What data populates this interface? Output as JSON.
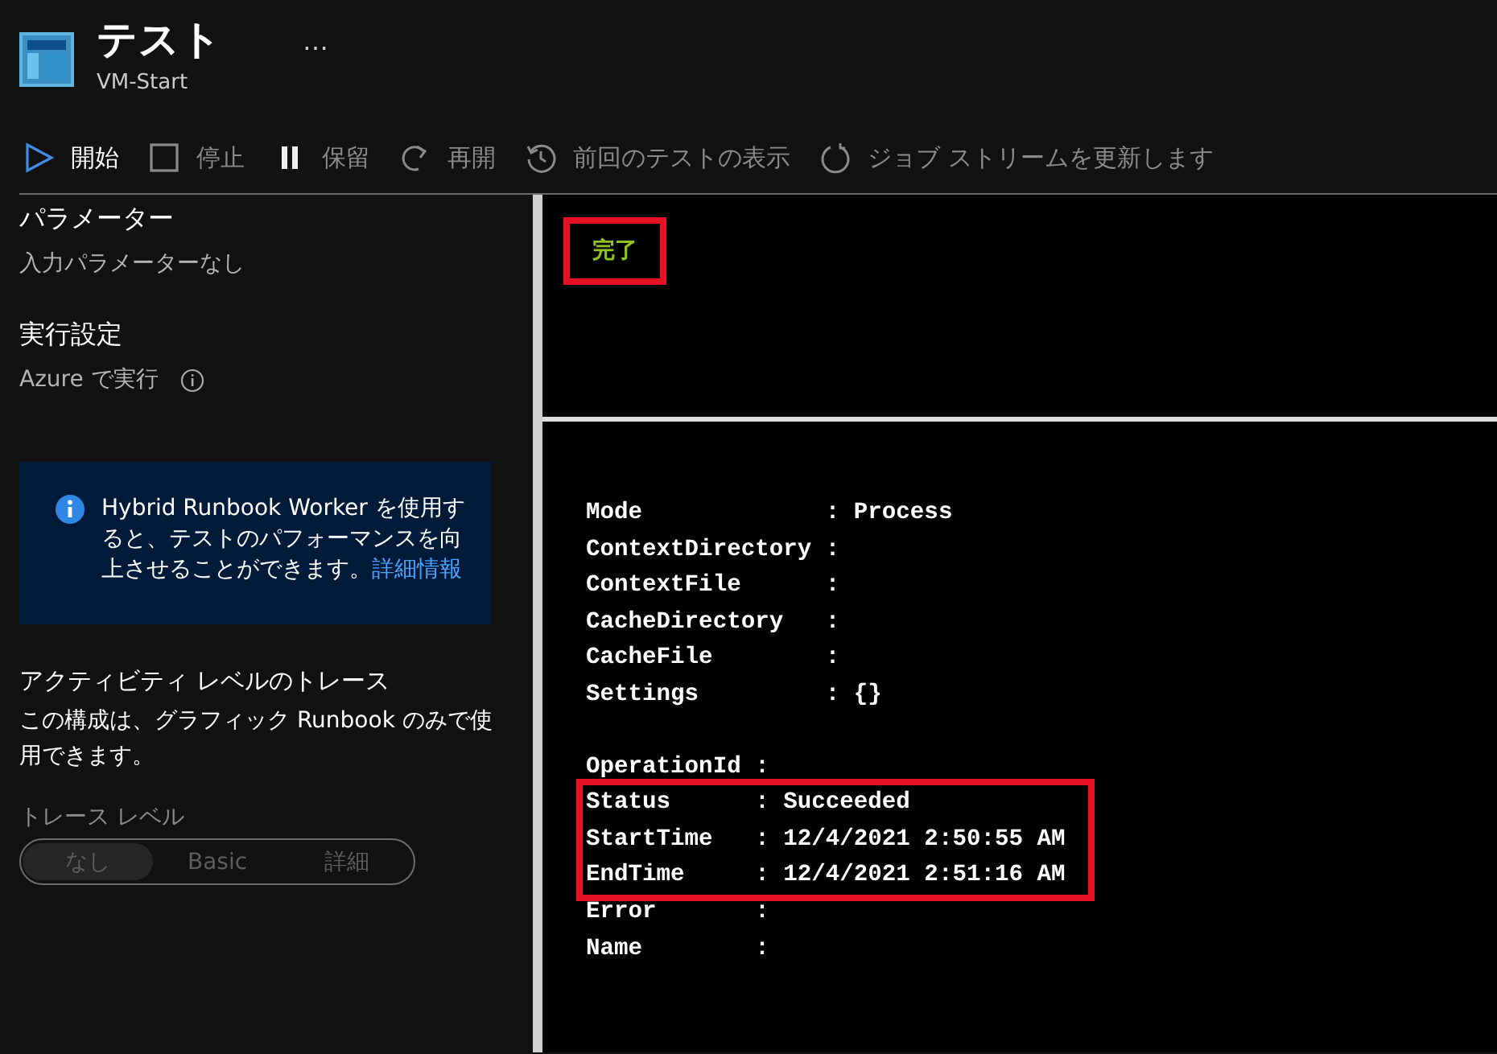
{
  "header": {
    "title": "テスト",
    "subtitle": "VM-Start",
    "more": "…"
  },
  "toolbar": [
    {
      "kind": "play",
      "label": "開始",
      "disabled": false
    },
    {
      "kind": "stop",
      "label": "停止",
      "disabled": true
    },
    {
      "kind": "pause",
      "label": "保留",
      "disabled": true
    },
    {
      "kind": "resume",
      "label": "再開",
      "disabled": true
    },
    {
      "kind": "history",
      "label": "前回のテストの表示",
      "disabled": true
    },
    {
      "kind": "refresh",
      "label": "ジョブ ストリームを更新します",
      "disabled": true
    }
  ],
  "sidebar": {
    "parameters_heading": "パラメーター",
    "parameters_text": "入力パラメーターなし",
    "run_heading": "実行設定",
    "run_text": "Azure で実行",
    "info_text": "Hybrid Runbook Worker を使用すると、テストのパフォーマンスを向上させることができます。",
    "info_link": "詳細情報",
    "trace_heading": "アクティビティ レベルのトレース",
    "trace_text": "この構成は、グラフィック Runbook のみで使用できます。",
    "trace_label": "トレース レベル",
    "trace_options": [
      {
        "label": "なし",
        "selected": true,
        "disabled": true
      },
      {
        "label": "Basic",
        "selected": false,
        "disabled": true
      },
      {
        "label": "詳細",
        "selected": false,
        "disabled": true
      }
    ]
  },
  "status": {
    "text": "完了",
    "highlighted": true
  },
  "output": [
    [
      {
        "text": "Mode             : Process",
        "highlighted": false
      },
      {
        "text": "ContextDirectory :",
        "highlighted": false
      },
      {
        "text": "ContextFile      :",
        "highlighted": false
      },
      {
        "text": "CacheDirectory   :",
        "highlighted": false
      },
      {
        "text": "CacheFile        :",
        "highlighted": false
      },
      {
        "text": "Settings         : {}",
        "highlighted": false
      }
    ],
    [
      {
        "text": "OperationId :",
        "highlighted": false
      },
      {
        "text": "Status      : Succeeded",
        "highlighted": true
      },
      {
        "text": "StartTime   : 12/4/2021 2:50:55 AM",
        "highlighted": true
      },
      {
        "text": "EndTime     : 12/4/2021 2:51:16 AM",
        "highlighted": true
      },
      {
        "text": "Error       :",
        "highlighted": false
      },
      {
        "text": "Name        :",
        "highlighted": false
      }
    ]
  ]
}
